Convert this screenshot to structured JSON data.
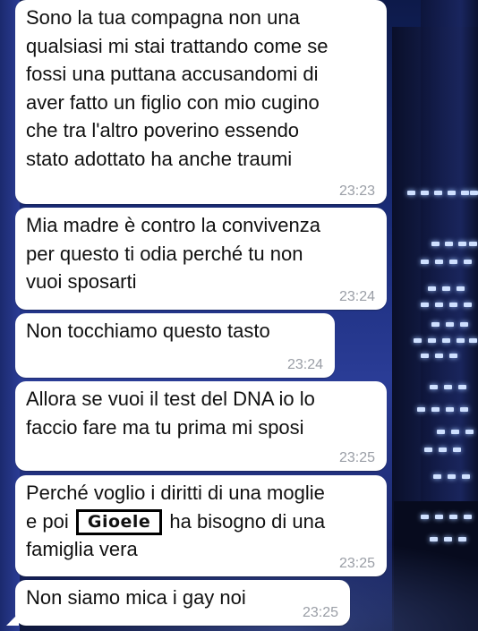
{
  "messages": [
    {
      "text": "Sono la tua compagna non una\nqualsiasi mi stai trattando come se\nfossi una puttana accusandomi di\naver fatto un figlio con mio cugino\nche tra l'altro poverino essendo\nstato adottato ha anche traumi",
      "time": "23:23"
    },
    {
      "text": "Mia madre è contro la convivenza\nper questo ti odia perché tu non\nvuoi sposarti",
      "time": "23:24"
    },
    {
      "text": "Non tocchiamo questo tasto",
      "time": "23:24"
    },
    {
      "text": "Allora se vuoi il test del DNA io lo\nfaccio fare ma tu prima mi sposi",
      "time": "23:25"
    },
    {
      "text_line1": "Perché voglio i diritti di una moglie",
      "text_pre": "e poi",
      "redacted_name": "Gioele",
      "text_post": "ha bisogno di una",
      "text_line3": "famiglia vera",
      "time": "23:25"
    },
    {
      "text": "Non siamo mica i gay noi",
      "time": "23:25"
    }
  ]
}
